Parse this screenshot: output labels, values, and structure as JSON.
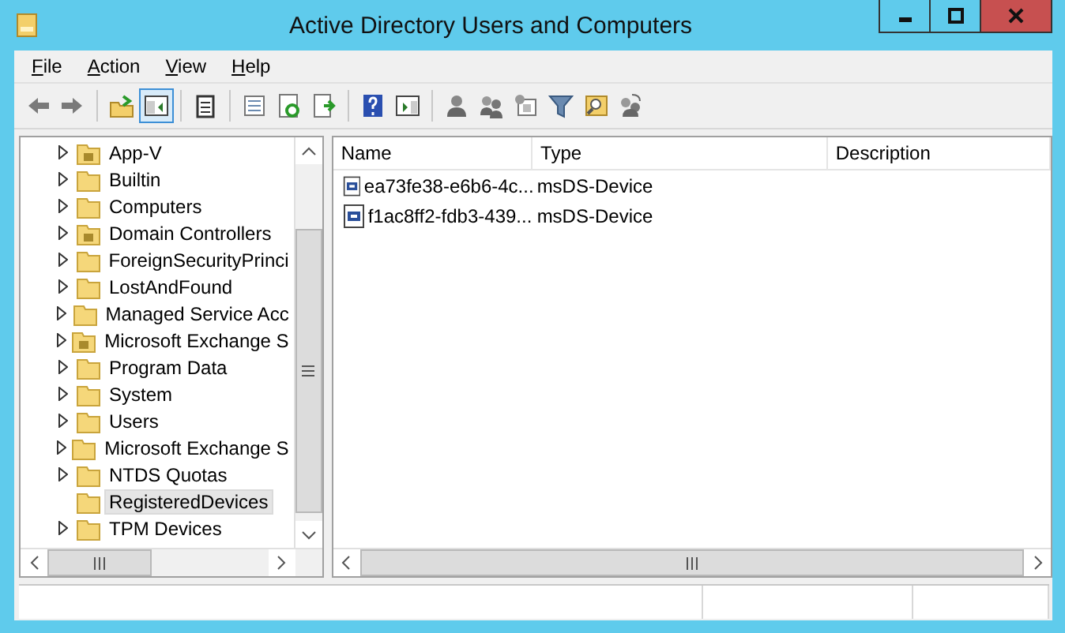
{
  "window": {
    "title": "Active Directory Users and Computers"
  },
  "menu": [
    {
      "label": "File"
    },
    {
      "label": "Action"
    },
    {
      "label": "View"
    },
    {
      "label": "Help"
    }
  ],
  "toolbar": [
    {
      "kind": "back",
      "pressed": false
    },
    {
      "kind": "forward",
      "pressed": false
    },
    {
      "kind": "sep"
    },
    {
      "kind": "up",
      "pressed": false
    },
    {
      "kind": "tree",
      "pressed": true
    },
    {
      "kind": "sep"
    },
    {
      "kind": "clipboard",
      "pressed": false
    },
    {
      "kind": "sep"
    },
    {
      "kind": "properties",
      "pressed": false
    },
    {
      "kind": "refresh",
      "pressed": false
    },
    {
      "kind": "export",
      "pressed": false
    },
    {
      "kind": "sep"
    },
    {
      "kind": "help",
      "pressed": false
    },
    {
      "kind": "panel",
      "pressed": false
    },
    {
      "kind": "sep"
    },
    {
      "kind": "user",
      "pressed": false
    },
    {
      "kind": "group",
      "pressed": false
    },
    {
      "kind": "ou",
      "pressed": false
    },
    {
      "kind": "filter",
      "pressed": false
    },
    {
      "kind": "find",
      "pressed": false
    },
    {
      "kind": "move",
      "pressed": false
    }
  ],
  "tree": {
    "items": [
      {
        "label": "App-V",
        "kind": "ou",
        "expandable": true,
        "selected": false
      },
      {
        "label": "Builtin",
        "kind": "container",
        "expandable": true,
        "selected": false
      },
      {
        "label": "Computers",
        "kind": "container",
        "expandable": true,
        "selected": false
      },
      {
        "label": "Domain Controllers",
        "kind": "ou",
        "expandable": true,
        "selected": false
      },
      {
        "label": "ForeignSecurityPrinci",
        "kind": "container",
        "expandable": true,
        "selected": false
      },
      {
        "label": "LostAndFound",
        "kind": "container",
        "expandable": true,
        "selected": false
      },
      {
        "label": "Managed Service Acc",
        "kind": "container",
        "expandable": true,
        "selected": false
      },
      {
        "label": "Microsoft Exchange S",
        "kind": "ou",
        "expandable": true,
        "selected": false
      },
      {
        "label": "Program Data",
        "kind": "container",
        "expandable": true,
        "selected": false
      },
      {
        "label": "System",
        "kind": "container",
        "expandable": true,
        "selected": false
      },
      {
        "label": "Users",
        "kind": "container",
        "expandable": true,
        "selected": false
      },
      {
        "label": "Microsoft Exchange S",
        "kind": "container",
        "expandable": true,
        "selected": false
      },
      {
        "label": "NTDS Quotas",
        "kind": "container",
        "expandable": true,
        "selected": false
      },
      {
        "label": "RegisteredDevices",
        "kind": "container",
        "expandable": false,
        "selected": true
      },
      {
        "label": "TPM Devices",
        "kind": "container",
        "expandable": true,
        "selected": false
      }
    ]
  },
  "table": {
    "columns": [
      "Name",
      "Type",
      "Description"
    ],
    "rows": [
      {
        "name": "ea73fe38-e6b6-4c...",
        "type": "msDS-Device"
      },
      {
        "name": "f1ac8ff2-fdb3-439...",
        "type": "msDS-Device"
      }
    ]
  }
}
